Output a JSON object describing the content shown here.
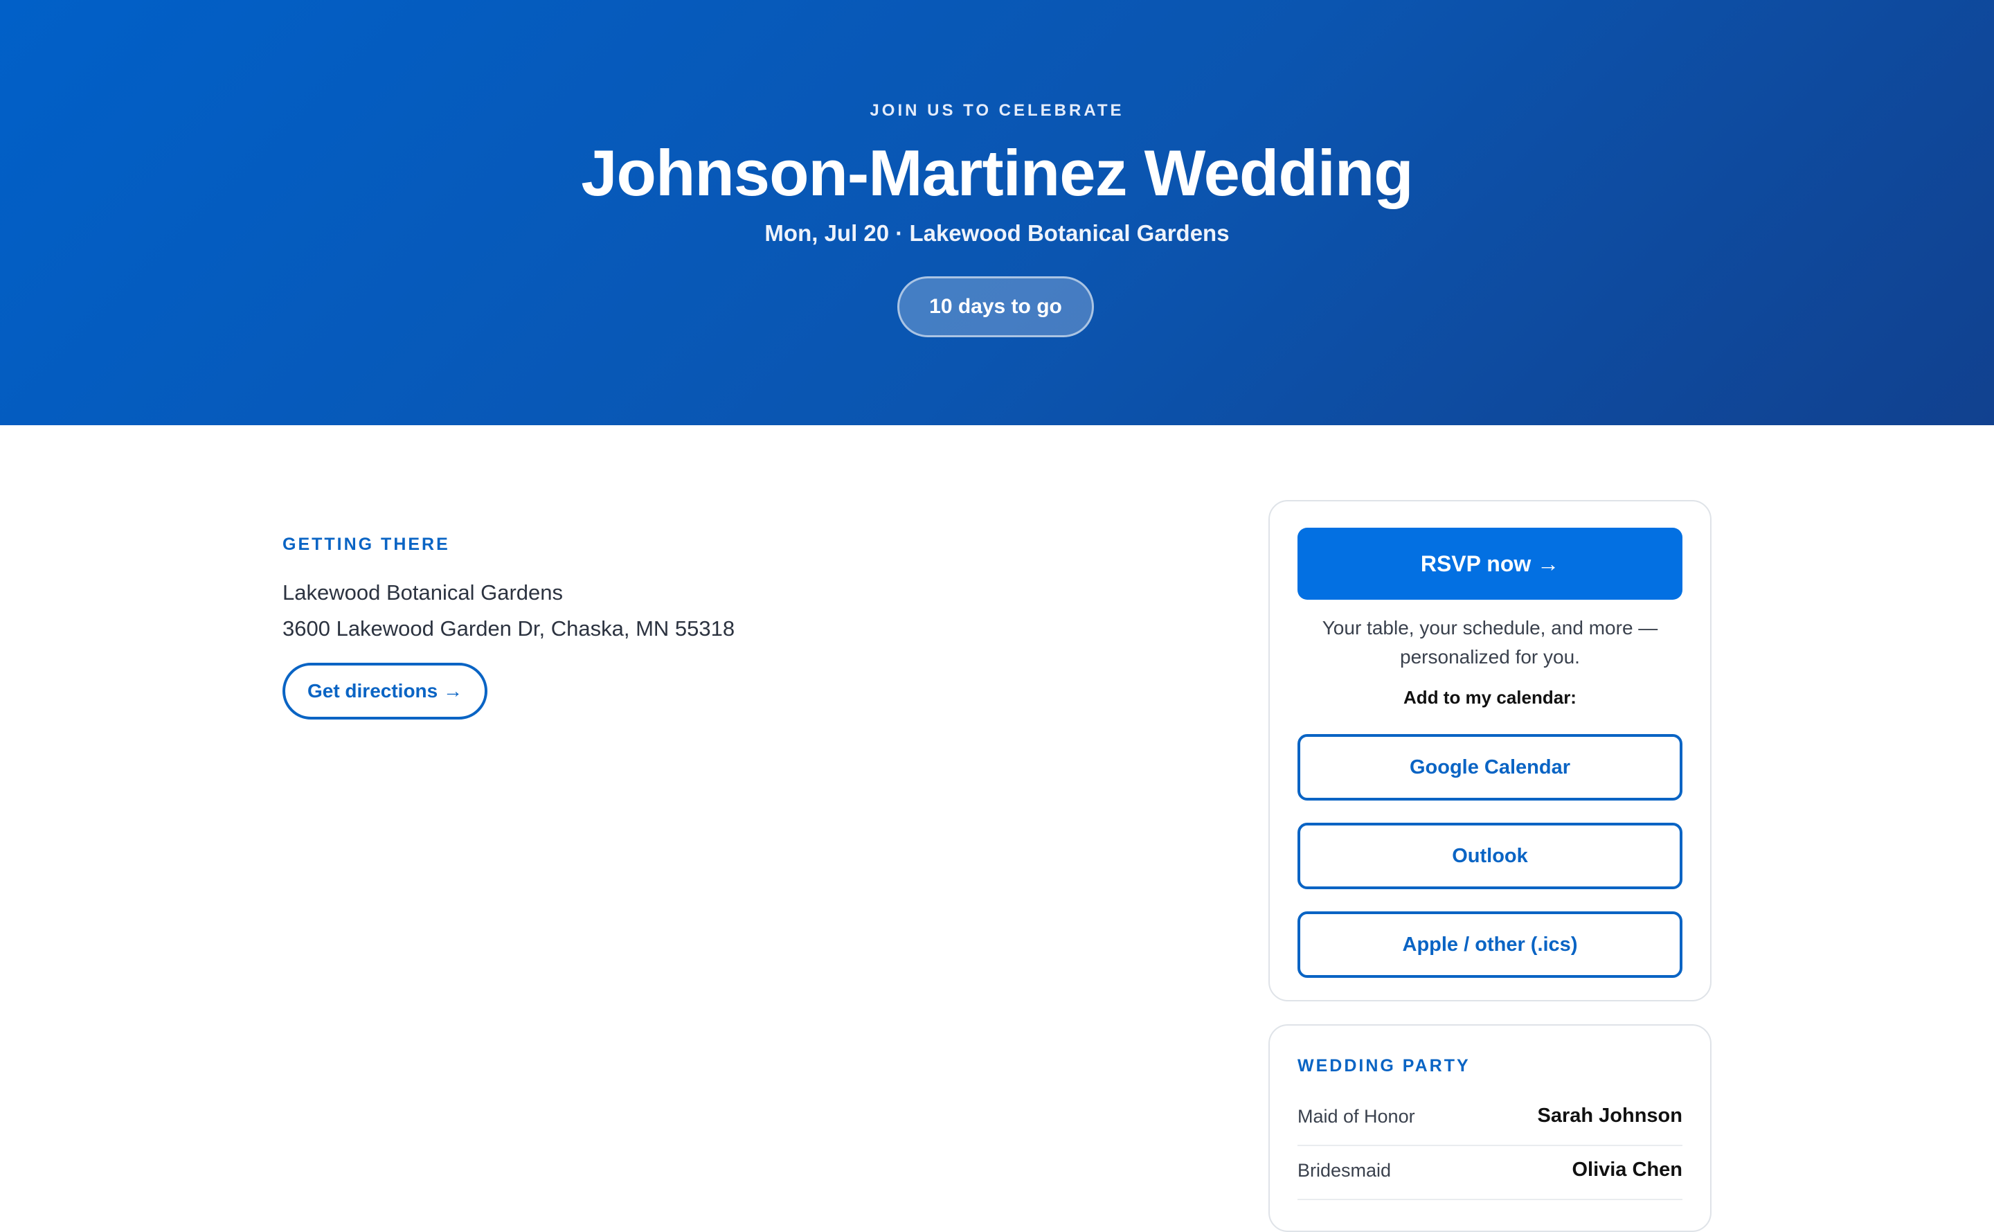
{
  "hero": {
    "eyebrow": "JOIN US TO CELEBRATE",
    "title": "Johnson-Martinez Wedding",
    "subtitle": "Mon, Jul 20 · Lakewood Botanical Gardens",
    "countdown": "10 days to go"
  },
  "getting_there": {
    "label": "GETTING THERE",
    "venue_name": "Lakewood Botanical Gardens",
    "address": "3600 Lakewood Garden Dr, Chaska, MN 55318",
    "directions_label": "Get directions →"
  },
  "rsvp": {
    "button_label": "RSVP now →",
    "note": "Your table, your schedule, and more — personalized for you.",
    "calendar_label": "Add to my calendar:",
    "calendar_options": [
      {
        "label": "Google Calendar"
      },
      {
        "label": "Outlook"
      },
      {
        "label": "Apple / other (.ics)"
      }
    ]
  },
  "wedding_party": {
    "label": "WEDDING PARTY",
    "members": [
      {
        "role": "Maid of Honor",
        "name": "Sarah Johnson"
      },
      {
        "role": "Bridesmaid",
        "name": "Olivia Chen"
      }
    ]
  },
  "colors": {
    "accent": "#0370e2",
    "link": "#0a64c4",
    "hero_start": "#0160c8",
    "hero_end": "#11418f"
  }
}
